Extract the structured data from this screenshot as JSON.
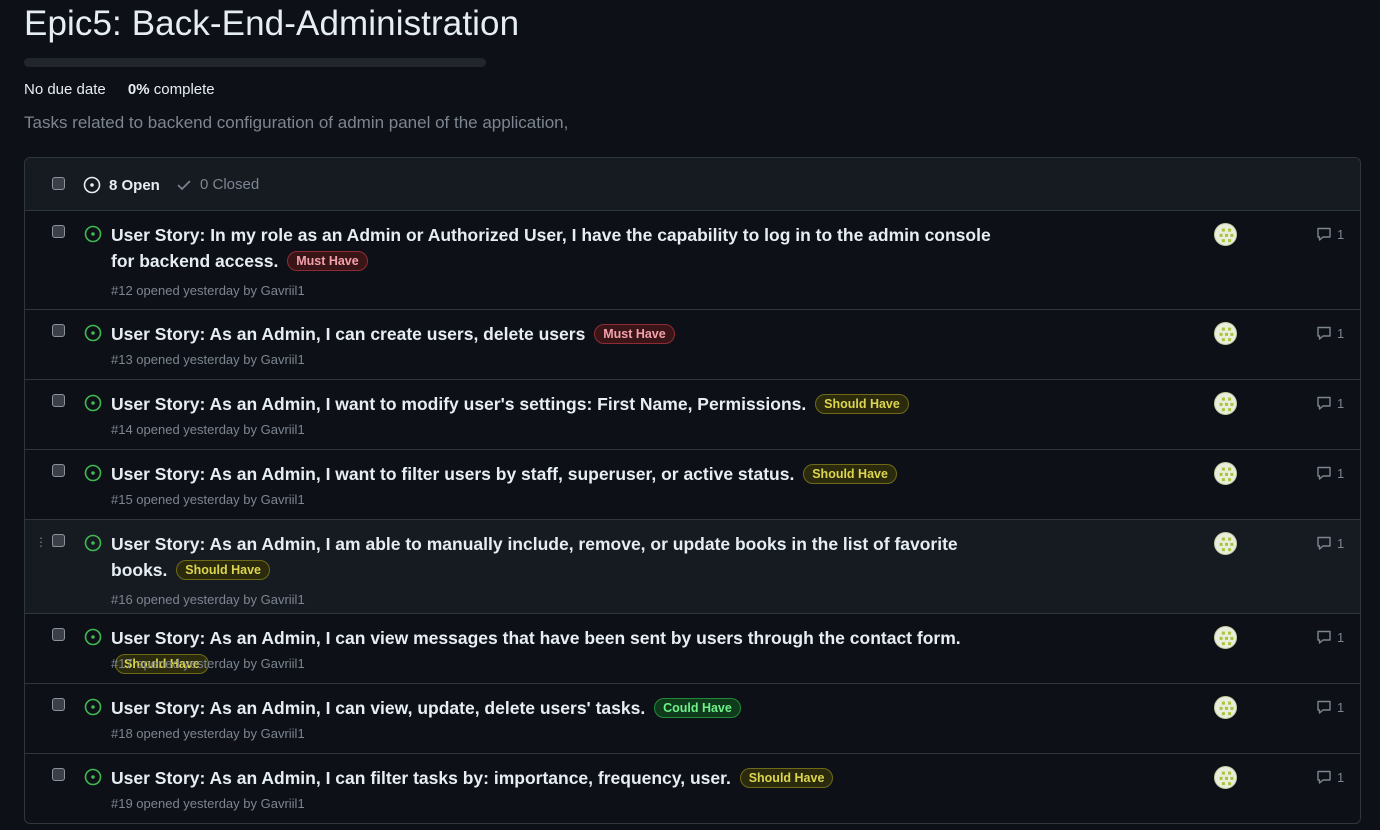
{
  "milestone": {
    "title": "Epic5: Back-End-Administration",
    "due_date": "No due date",
    "percent_value": "0%",
    "percent_suffix": " complete",
    "progress_fraction": 0,
    "description": "Tasks related to backend configuration of admin panel of the application,"
  },
  "list_header": {
    "open_label": "8 Open",
    "closed_label": "0 Closed"
  },
  "issues": [
    {
      "title": "User Story: In my role as an Admin or Authorized User, I have the capability to log in to the admin console for backend access.",
      "label": "Must Have",
      "label_kind": "must",
      "meta": "#12 opened yesterday by Gavriil1",
      "comments": "1"
    },
    {
      "title": "User Story: As an Admin, I can create users, delete users",
      "label": "Must Have",
      "label_kind": "must",
      "meta": "#13 opened yesterday by Gavriil1",
      "comments": "1"
    },
    {
      "title": "User Story: As an Admin, I want to modify user's settings: First Name, Permissions.",
      "label": "Should Have",
      "label_kind": "should",
      "meta": "#14 opened yesterday by Gavriil1",
      "comments": "1"
    },
    {
      "title": "User Story: As an Admin, I want to filter users by staff, superuser, or active status.",
      "label": "Should Have",
      "label_kind": "should",
      "meta": "#15 opened yesterday by Gavriil1",
      "comments": "1"
    },
    {
      "title": "User Story: As an Admin, I am able to manually include, remove, or update books in the list of favorite books.",
      "label": "Should Have",
      "label_kind": "should",
      "meta": "#16 opened yesterday by Gavriil1",
      "comments": "1"
    },
    {
      "title": "User Story: As an Admin, I can view messages that have been sent by users through the contact form.",
      "label": "Should Have",
      "label_kind": "should",
      "meta": "#17 opened yesterday by Gavriil1",
      "comments": "1"
    },
    {
      "title": "User Story: As an Admin, I can view, update, delete users' tasks.",
      "label": "Could Have",
      "label_kind": "could",
      "meta": "#18 opened yesterday by Gavriil1",
      "comments": "1"
    },
    {
      "title": "User Story: As an Admin, I can filter tasks by: importance, frequency, user.",
      "label": "Should Have",
      "label_kind": "should",
      "meta": "#19 opened yesterday by Gavriil1",
      "comments": "1"
    }
  ],
  "colors": {
    "open_icon": "#3fb950",
    "must_have": "#f2a0a9",
    "should_have": "#dcd54e",
    "could_have": "#6ef08a"
  },
  "icons": {
    "open": "issue-opened-icon",
    "closed": "check-icon",
    "comment": "comment-icon",
    "drag": "drag-handle-icon"
  }
}
